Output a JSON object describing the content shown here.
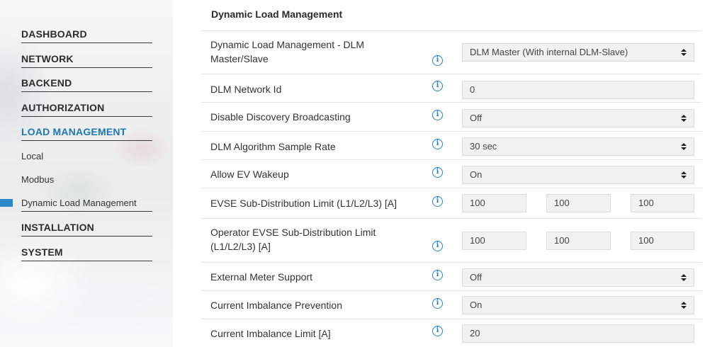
{
  "sidebar": {
    "nav": [
      {
        "label": "DASHBOARD",
        "active": false
      },
      {
        "label": "NETWORK",
        "active": false
      },
      {
        "label": "BACKEND",
        "active": false
      },
      {
        "label": "AUTHORIZATION",
        "active": false
      },
      {
        "label": "LOAD MANAGEMENT",
        "active": true
      }
    ],
    "sub_items": [
      {
        "label": "Local"
      },
      {
        "label": "Modbus"
      },
      {
        "label": "Dynamic Load Management",
        "selected": true
      }
    ],
    "nav_after": [
      {
        "label": "INSTALLATION"
      },
      {
        "label": "SYSTEM"
      }
    ]
  },
  "main": {
    "title": "Dynamic Load Management",
    "rows": [
      {
        "label_line1": "Dynamic Load Management - DLM",
        "label_line2": "Master/Slave",
        "type": "select",
        "value": "DLM Master (With internal DLM-Slave)"
      },
      {
        "label": "DLM Network Id",
        "type": "input",
        "value": "0"
      },
      {
        "label": "Disable Discovery Broadcasting",
        "type": "select",
        "value": "Off"
      },
      {
        "label": "DLM Algorithm Sample Rate",
        "type": "select",
        "value": "30 sec"
      },
      {
        "label": "Allow EV Wakeup",
        "type": "select",
        "value": "On"
      },
      {
        "label": "EVSE Sub-Distribution Limit (L1/L2/L3) [A]",
        "type": "triple",
        "values": [
          "100",
          "100",
          "100"
        ]
      },
      {
        "label_line1": "Operator EVSE Sub-Distribution Limit",
        "label_line2": "(L1/L2/L3) [A]",
        "type": "triple",
        "values": [
          "100",
          "100",
          "100"
        ]
      },
      {
        "label": "External Meter Support",
        "type": "select",
        "value": "Off"
      },
      {
        "label": "Current Imbalance Prevention",
        "type": "select",
        "value": "On"
      },
      {
        "label": "Current Imbalance Limit [A]",
        "type": "input",
        "value": "20"
      }
    ],
    "info_glyph": "i"
  },
  "colors": {
    "accent": "#1e78b4",
    "marker": "#2a87c8",
    "field_bg": "#f1f1f1",
    "info": "#2a7fc0"
  }
}
